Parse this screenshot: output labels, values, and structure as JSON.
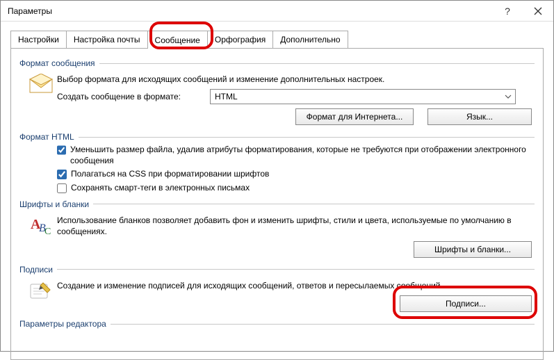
{
  "window": {
    "title": "Параметры"
  },
  "tabs": {
    "items": [
      {
        "label": "Настройки"
      },
      {
        "label": "Настройка почты"
      },
      {
        "label": "Сообщение"
      },
      {
        "label": "Орфография"
      },
      {
        "label": "Дополнительно"
      }
    ],
    "active_index": 2
  },
  "group_format": {
    "title": "Формат сообщения",
    "desc": "Выбор формата для исходящих сообщений и изменение дополнительных настроек.",
    "create_label": "Создать сообщение в формате:",
    "format_value": "HTML",
    "btn_internet": "Формат для Интернета...",
    "btn_lang": "Язык..."
  },
  "group_html": {
    "title": "Формат HTML",
    "check1": "Уменьшить размер файла, удалив атрибуты форматирования, которые не требуются при отображении электронного сообщения",
    "check2": "Полагаться на CSS при форматировании шрифтов",
    "check3": "Сохранять смарт-теги в электронных письмах",
    "check1_on": true,
    "check2_on": true,
    "check3_on": false
  },
  "group_fonts": {
    "title": "Шрифты и бланки",
    "desc": "Использование бланков позволяет добавить фон и изменить шрифты, стили и цвета, используемые по умолчанию в сообщениях.",
    "btn": "Шрифты и бланки..."
  },
  "group_sign": {
    "title": "Подписи",
    "desc": "Создание и изменение подписей для исходящих сообщений, ответов и пересылаемых сообщений.",
    "btn": "Подписи..."
  },
  "group_editor": {
    "title": "Параметры редактора"
  }
}
